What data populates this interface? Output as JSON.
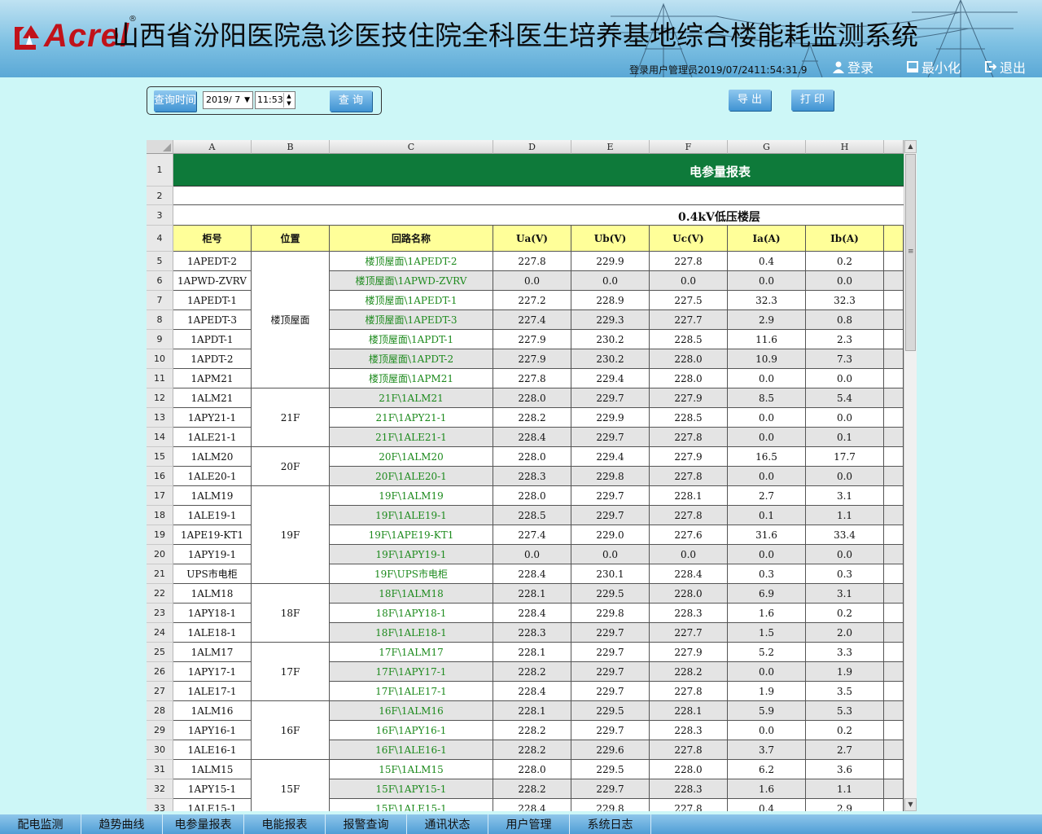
{
  "header": {
    "logo_text": "Acrel",
    "logo_reg": "®",
    "title": "山西省汾阳医院急诊医技住院全科医生培养基地综合楼能耗监测系统",
    "login_info": "登录用户管理员2019/07/2411:54:31.9",
    "buttons": [
      {
        "label": "登录",
        "icon": "user-icon"
      },
      {
        "label": "最小化",
        "icon": "minimize-icon"
      },
      {
        "label": "退出",
        "icon": "exit-icon"
      }
    ]
  },
  "query": {
    "time_label": "查询时间",
    "date_value": "2019/ 7",
    "time_value": "11:53",
    "query_button": "查 询",
    "export_button": "导 出",
    "print_button": "打 印"
  },
  "sheet": {
    "col_letters": [
      "A",
      "B",
      "C",
      "D",
      "E",
      "F",
      "G",
      "H"
    ],
    "title": "电参量报表",
    "subtitle": "0.4kV低压楼层",
    "headers": [
      "柜号",
      "位置",
      "回路名称",
      "Ua(V)",
      "Ub(V)",
      "Uc(V)",
      "Ia(A)",
      "Ib(A)"
    ],
    "row_numbers": [
      "1",
      "2",
      "3",
      "4",
      "5",
      "6",
      "7",
      "8",
      "9",
      "10",
      "11",
      "12",
      "13",
      "14",
      "15",
      "16",
      "17",
      "18",
      "19",
      "20",
      "21",
      "22",
      "23",
      "24",
      "25",
      "26",
      "27",
      "28",
      "29",
      "30",
      "31",
      "32",
      "33"
    ],
    "groups": [
      {
        "position": "楼顶屋面",
        "start": 0,
        "span": 7
      },
      {
        "position": "21F",
        "start": 7,
        "span": 3
      },
      {
        "position": "20F",
        "start": 10,
        "span": 2
      },
      {
        "position": "19F",
        "start": 12,
        "span": 5
      },
      {
        "position": "18F",
        "start": 17,
        "span": 3
      },
      {
        "position": "17F",
        "start": 20,
        "span": 3
      },
      {
        "position": "16F",
        "start": 23,
        "span": 3
      },
      {
        "position": "15F",
        "start": 26,
        "span": 3
      }
    ],
    "rows": [
      {
        "cabinet": "1APEDT-2",
        "circuit": "楼顶屋面\\1APEDT-2",
        "ua": "227.8",
        "ub": "229.9",
        "uc": "227.8",
        "ia": "0.4",
        "ib": "0.2"
      },
      {
        "cabinet": "1APWD-ZVRV",
        "circuit": "楼顶屋面\\1APWD-ZVRV",
        "ua": "0.0",
        "ub": "0.0",
        "uc": "0.0",
        "ia": "0.0",
        "ib": "0.0"
      },
      {
        "cabinet": "1APEDT-1",
        "circuit": "楼顶屋面\\1APEDT-1",
        "ua": "227.2",
        "ub": "228.9",
        "uc": "227.5",
        "ia": "32.3",
        "ib": "32.3"
      },
      {
        "cabinet": "1APEDT-3",
        "circuit": "楼顶屋面\\1APEDT-3",
        "ua": "227.4",
        "ub": "229.3",
        "uc": "227.7",
        "ia": "2.9",
        "ib": "0.8"
      },
      {
        "cabinet": "1APDT-1",
        "circuit": "楼顶屋面\\1APDT-1",
        "ua": "227.9",
        "ub": "230.2",
        "uc": "228.5",
        "ia": "11.6",
        "ib": "2.3"
      },
      {
        "cabinet": "1APDT-2",
        "circuit": "楼顶屋面\\1APDT-2",
        "ua": "227.9",
        "ub": "230.2",
        "uc": "228.0",
        "ia": "10.9",
        "ib": "7.3"
      },
      {
        "cabinet": "1APM21",
        "circuit": "楼顶屋面\\1APM21",
        "ua": "227.8",
        "ub": "229.4",
        "uc": "228.0",
        "ia": "0.0",
        "ib": "0.0"
      },
      {
        "cabinet": "1ALM21",
        "circuit": "21F\\1ALM21",
        "ua": "228.0",
        "ub": "229.7",
        "uc": "227.9",
        "ia": "8.5",
        "ib": "5.4"
      },
      {
        "cabinet": "1APY21-1",
        "circuit": "21F\\1APY21-1",
        "ua": "228.2",
        "ub": "229.9",
        "uc": "228.5",
        "ia": "0.0",
        "ib": "0.0"
      },
      {
        "cabinet": "1ALE21-1",
        "circuit": "21F\\1ALE21-1",
        "ua": "228.4",
        "ub": "229.7",
        "uc": "227.8",
        "ia": "0.0",
        "ib": "0.1"
      },
      {
        "cabinet": "1ALM20",
        "circuit": "20F\\1ALM20",
        "ua": "228.0",
        "ub": "229.4",
        "uc": "227.9",
        "ia": "16.5",
        "ib": "17.7"
      },
      {
        "cabinet": "1ALE20-1",
        "circuit": "20F\\1ALE20-1",
        "ua": "228.3",
        "ub": "229.8",
        "uc": "227.8",
        "ia": "0.0",
        "ib": "0.0"
      },
      {
        "cabinet": "1ALM19",
        "circuit": "19F\\1ALM19",
        "ua": "228.0",
        "ub": "229.7",
        "uc": "228.1",
        "ia": "2.7",
        "ib": "3.1"
      },
      {
        "cabinet": "1ALE19-1",
        "circuit": "19F\\1ALE19-1",
        "ua": "228.5",
        "ub": "229.7",
        "uc": "227.8",
        "ia": "0.1",
        "ib": "1.1"
      },
      {
        "cabinet": "1APE19-KT1",
        "circuit": "19F\\1APE19-KT1",
        "ua": "227.4",
        "ub": "229.0",
        "uc": "227.6",
        "ia": "31.6",
        "ib": "33.4"
      },
      {
        "cabinet": "1APY19-1",
        "circuit": "19F\\1APY19-1",
        "ua": "0.0",
        "ub": "0.0",
        "uc": "0.0",
        "ia": "0.0",
        "ib": "0.0"
      },
      {
        "cabinet": "UPS市电柜",
        "circuit": "19F\\UPS市电柜",
        "ua": "228.4",
        "ub": "230.1",
        "uc": "228.4",
        "ia": "0.3",
        "ib": "0.3"
      },
      {
        "cabinet": "1ALM18",
        "circuit": "18F\\1ALM18",
        "ua": "228.1",
        "ub": "229.5",
        "uc": "228.0",
        "ia": "6.9",
        "ib": "3.1"
      },
      {
        "cabinet": "1APY18-1",
        "circuit": "18F\\1APY18-1",
        "ua": "228.4",
        "ub": "229.8",
        "uc": "228.3",
        "ia": "1.6",
        "ib": "0.2"
      },
      {
        "cabinet": "1ALE18-1",
        "circuit": "18F\\1ALE18-1",
        "ua": "228.3",
        "ub": "229.7",
        "uc": "227.7",
        "ia": "1.5",
        "ib": "2.0"
      },
      {
        "cabinet": "1ALM17",
        "circuit": "17F\\1ALM17",
        "ua": "228.1",
        "ub": "229.7",
        "uc": "227.9",
        "ia": "5.2",
        "ib": "3.3"
      },
      {
        "cabinet": "1APY17-1",
        "circuit": "17F\\1APY17-1",
        "ua": "228.2",
        "ub": "229.7",
        "uc": "228.2",
        "ia": "0.0",
        "ib": "1.9"
      },
      {
        "cabinet": "1ALE17-1",
        "circuit": "17F\\1ALE17-1",
        "ua": "228.4",
        "ub": "229.7",
        "uc": "227.8",
        "ia": "1.9",
        "ib": "3.5"
      },
      {
        "cabinet": "1ALM16",
        "circuit": "16F\\1ALM16",
        "ua": "228.1",
        "ub": "229.5",
        "uc": "228.1",
        "ia": "5.9",
        "ib": "5.3"
      },
      {
        "cabinet": "1APY16-1",
        "circuit": "16F\\1APY16-1",
        "ua": "228.2",
        "ub": "229.7",
        "uc": "228.3",
        "ia": "0.0",
        "ib": "0.2"
      },
      {
        "cabinet": "1ALE16-1",
        "circuit": "16F\\1ALE16-1",
        "ua": "228.2",
        "ub": "229.6",
        "uc": "227.8",
        "ia": "3.7",
        "ib": "2.7"
      },
      {
        "cabinet": "1ALM15",
        "circuit": "15F\\1ALM15",
        "ua": "228.0",
        "ub": "229.5",
        "uc": "228.0",
        "ia": "6.2",
        "ib": "3.6"
      },
      {
        "cabinet": "1APY15-1",
        "circuit": "15F\\1APY15-1",
        "ua": "228.2",
        "ub": "229.7",
        "uc": "228.3",
        "ia": "1.6",
        "ib": "1.1"
      },
      {
        "cabinet": "1ALE15-1",
        "circuit": "15F\\1ALE15-1",
        "ua": "228.4",
        "ub": "229.8",
        "uc": "227.8",
        "ia": "0.4",
        "ib": "2.9"
      }
    ]
  },
  "nav": [
    "配电监测",
    "趋势曲线",
    "电参量报表",
    "电能报表",
    "报警查询",
    "通讯状态",
    "用户管理",
    "系统日志"
  ]
}
